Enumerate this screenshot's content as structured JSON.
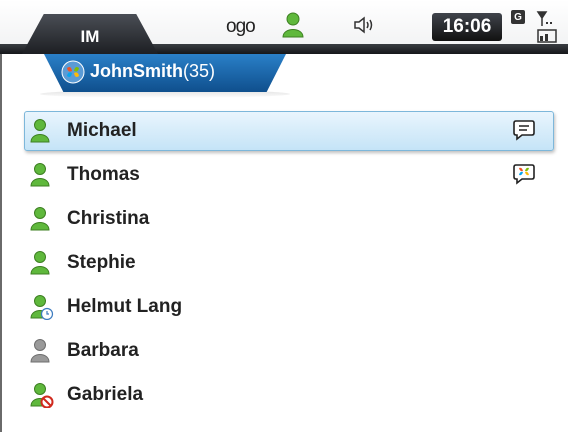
{
  "status_bar": {
    "tab_label": "IM",
    "network_label": "ogo",
    "clock": "16:06",
    "gprs": "G"
  },
  "account": {
    "name": "JohnSmith",
    "count": "(35)"
  },
  "contacts": [
    {
      "name": "Michael",
      "status": "online",
      "selected": true,
      "right_icon": "message-icon"
    },
    {
      "name": "Thomas",
      "status": "online",
      "selected": false,
      "right_icon": "msn-chat-icon"
    },
    {
      "name": "Christina",
      "status": "online",
      "selected": false,
      "right_icon": ""
    },
    {
      "name": "Stephie",
      "status": "online",
      "selected": false,
      "right_icon": ""
    },
    {
      "name": "Helmut Lang",
      "status": "away",
      "selected": false,
      "right_icon": ""
    },
    {
      "name": "Barbara",
      "status": "offline",
      "selected": false,
      "right_icon": ""
    },
    {
      "name": "Gabriela",
      "status": "blocked",
      "selected": false,
      "right_icon": ""
    }
  ],
  "colors": {
    "online": "#5fb83c",
    "offline": "#9a9a9a",
    "accent": "#1a63a8",
    "selection": "#c5e4f7"
  }
}
